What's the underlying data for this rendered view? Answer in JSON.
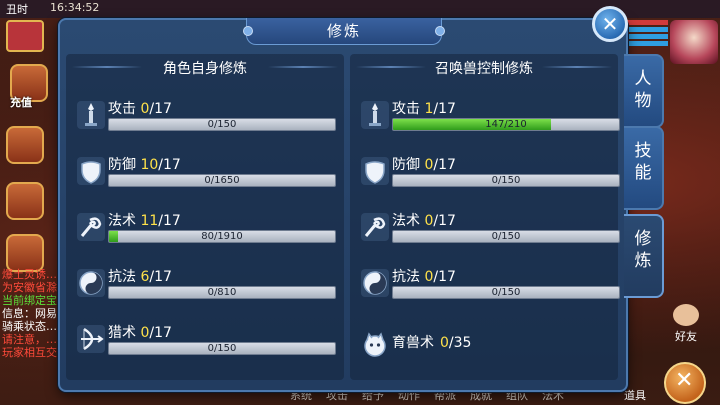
{
  "background": {
    "top_time": "丑时",
    "clock": "16:34:52",
    "recharge_label": "充值",
    "chat_lines": [
      {
        "text": "爆土灵诱…",
        "color": "#ff4a3a"
      },
      {
        "text": "为安徽省滁…",
        "color": "#ff4a3a"
      },
      {
        "text": "当前绑定宝…",
        "color": "#5ce03a"
      },
      {
        "text": "信息：网易…",
        "color": "#ffffff"
      },
      {
        "text": "骑乘状态…",
        "color": "#ffffff"
      },
      {
        "text": "请注意，…",
        "color": "#ff4a3a"
      },
      {
        "text": "玩家相互交…",
        "color": "#ff4a3a"
      }
    ],
    "friends_label": "好友",
    "bottom_menu": [
      "系统",
      "攻击",
      "给予",
      "动作",
      "帮派",
      "成就",
      "组队",
      "法术"
    ],
    "items_label": "道具"
  },
  "dialog": {
    "title": "修炼",
    "close_icon": "close-icon",
    "left_panel": {
      "header": "角色自身修炼",
      "rows": [
        {
          "icon": "attack-icon",
          "name": "攻击",
          "level": "0",
          "max": "/17",
          "progress_text": "0/150",
          "progress": 0.0
        },
        {
          "icon": "defense-icon",
          "name": "防御",
          "level": "10",
          "max": "/17",
          "progress_text": "0/1650",
          "progress": 0.0
        },
        {
          "icon": "magic-icon",
          "name": "法术",
          "level": "11",
          "max": "/17",
          "progress_text": "80/1910",
          "progress": 0.042
        },
        {
          "icon": "resist-icon",
          "name": "抗法",
          "level": "6",
          "max": "/17",
          "progress_text": "0/810",
          "progress": 0.0
        },
        {
          "icon": "hunt-icon",
          "name": "猎术",
          "level": "0",
          "max": "/17",
          "progress_text": "0/150",
          "progress": 0.0
        }
      ]
    },
    "right_panel": {
      "header": "召唤兽控制修炼",
      "rows": [
        {
          "icon": "attack-icon",
          "name": "攻击",
          "level": "1",
          "max": "/17",
          "progress_text": "147/210",
          "progress": 0.7
        },
        {
          "icon": "defense-icon",
          "name": "防御",
          "level": "0",
          "max": "/17",
          "progress_text": "0/150",
          "progress": 0.0
        },
        {
          "icon": "magic-icon",
          "name": "法术",
          "level": "0",
          "max": "/17",
          "progress_text": "0/150",
          "progress": 0.0
        },
        {
          "icon": "resist-icon",
          "name": "抗法",
          "level": "0",
          "max": "/17",
          "progress_text": "0/150",
          "progress": 0.0
        }
      ],
      "beast": {
        "icon": "beast-icon",
        "name": "育兽术",
        "level": "0",
        "max": "/35"
      }
    },
    "tabs": [
      {
        "label": "人物",
        "active": false
      },
      {
        "label": "技能",
        "active": false
      },
      {
        "label": "修炼",
        "active": true
      }
    ]
  }
}
